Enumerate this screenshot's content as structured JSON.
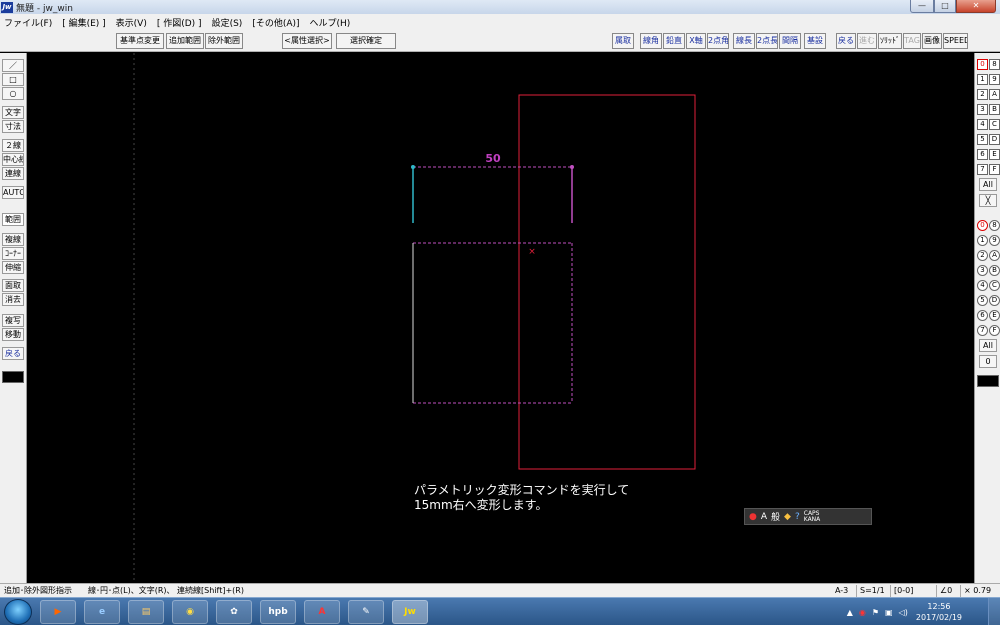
{
  "window": {
    "app_icon": "Jw",
    "title": "無題 - jw_win",
    "min": "—",
    "max": "□",
    "close": "✕"
  },
  "menu": [
    "ファイル(F)",
    "[ 編集(E) ]",
    "表示(V)",
    "[ 作図(D) ]",
    "設定(S)",
    "[その他(A)]",
    "ヘルプ(H)"
  ],
  "toolbar": {
    "left": [
      "基準点変更",
      "追加範囲",
      "除外範囲",
      "<属性選択>",
      "選択確定"
    ],
    "right": [
      "属取",
      "線角",
      "鉛直",
      "X軸",
      "2点角",
      "線長",
      "2点長",
      "間隔",
      "基設",
      "戻る",
      "進む",
      "ｿﾘｯﾄﾞ",
      "TAG",
      "画像",
      "SPEED"
    ]
  },
  "left_tools": [
    "／",
    "□",
    "○",
    "文字",
    "寸法",
    "２線",
    "中心線",
    "連線",
    "AUTO",
    "範囲",
    "複線",
    "ｺｰﾅｰ",
    "伸縮",
    "面取",
    "消去",
    "複写",
    "移動",
    "戻る"
  ],
  "right_tools": {
    "layer_groups": [
      "0",
      "8",
      "1",
      "9",
      "2",
      "A",
      "3",
      "B",
      "4",
      "C",
      "5",
      "D",
      "6",
      "E",
      "7",
      "F"
    ],
    "all_label": "All",
    "cross_label": "╳",
    "layers": [
      "0",
      "8",
      "1",
      "9",
      "2",
      "A",
      "3",
      "B",
      "4",
      "C",
      "5",
      "D",
      "6",
      "E",
      "7",
      "F"
    ],
    "all2_label": "All",
    "zero_label": "0"
  },
  "drawing": {
    "dimension_label": "50",
    "message_line1": "パラメトリック変形コマンドを実行して",
    "message_line2": "15mm右へ変形します。"
  },
  "ime": {
    "mode": "A",
    "label": "般",
    "caps": "CAPS",
    "kana": "KANA"
  },
  "status": {
    "left": "追加･除外図形指示",
    "hint": "線･円･点(L)、文字(R)、 連続線[Shift]+(R)",
    "paper": "A-3",
    "scale": "S=1/1",
    "layer": "[0-0]",
    "angle": "∠0",
    "zoom": "× 0.79"
  },
  "taskbar": {
    "apps": [
      "▶",
      "e",
      "▤",
      "◉",
      "✿",
      "hpb",
      "A",
      "✎",
      "Jw"
    ],
    "time": "12:56",
    "date": "2017/02/19"
  },
  "colors": {
    "rect_red": "#e0203a",
    "dashed_magenta": "#c050c0",
    "cyan": "#30b8c8",
    "dim_text": "#c040c0"
  }
}
